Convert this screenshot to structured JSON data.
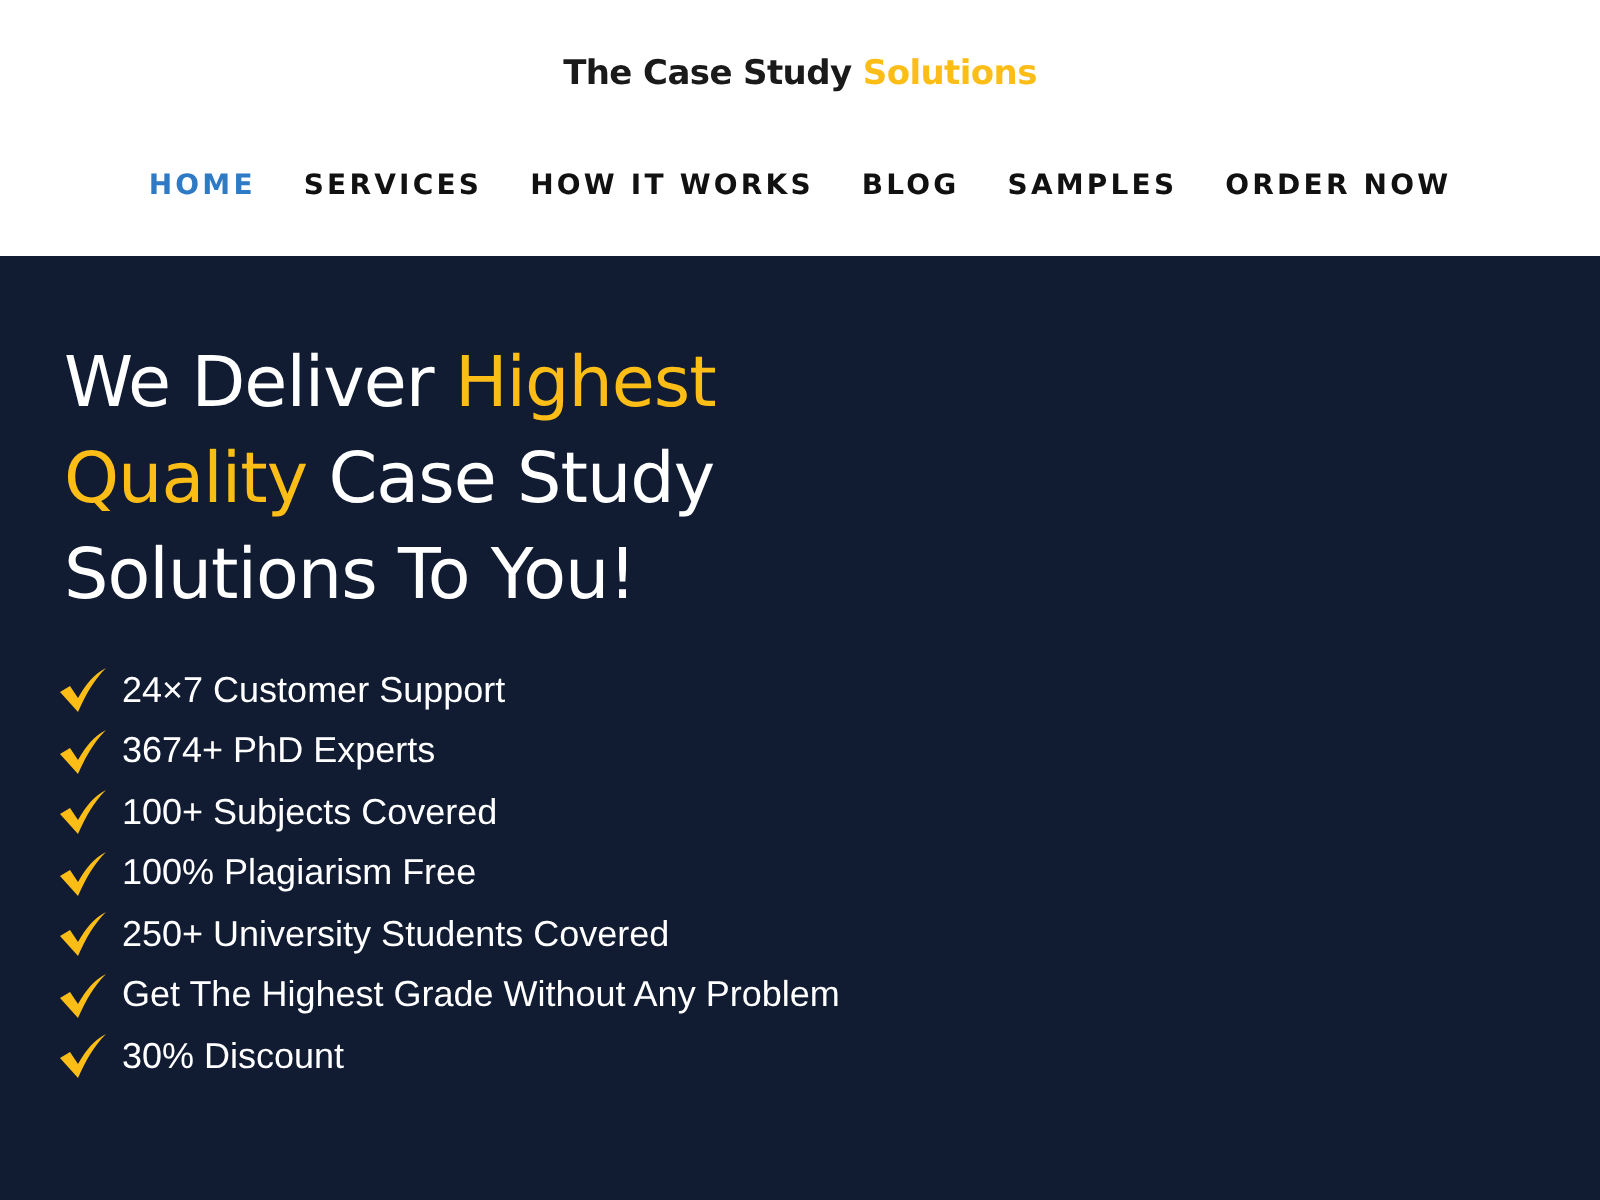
{
  "logo": {
    "parts": [
      {
        "text": "The Case Study",
        "highlight": false
      },
      {
        "text": "Solutions",
        "highlight": true
      }
    ]
  },
  "nav": [
    {
      "label": "HOME",
      "selected": true
    },
    {
      "label": "SERVICES",
      "selected": false
    },
    {
      "label": "HOW IT WORKS",
      "selected": false
    },
    {
      "label": "BLOG",
      "selected": false
    },
    {
      "label": "SAMPLES",
      "selected": false
    },
    {
      "label": "ORDER NOW",
      "selected": false
    }
  ],
  "hero": {
    "heading": [
      {
        "text": "We Deliver",
        "highlight": false
      },
      {
        "text": "Highest Quality",
        "highlight": true
      },
      {
        "text": "Case Study Solutions To You!",
        "highlight": false
      }
    ],
    "features": [
      "24×7 Customer Support",
      "3674+ PhD Experts",
      "100+ Subjects Covered",
      "100% Plagiarism Free",
      "250+ University Students Covered",
      "Get The Highest Grade Without Any Problem",
      "30% Discount"
    ]
  }
}
